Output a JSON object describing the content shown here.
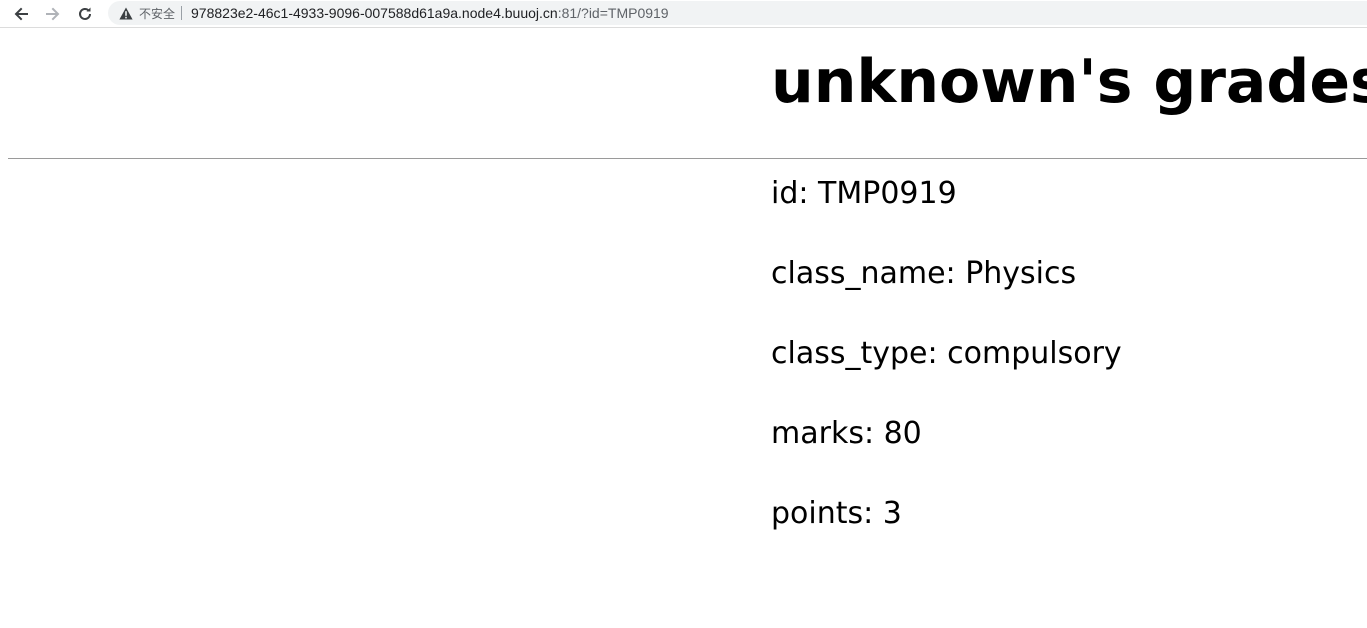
{
  "browser": {
    "security_label": "不安全",
    "url_host": "978823e2-46c1-4933-9096-007588d61a9a.node4.buuoj.cn",
    "url_rest": ":81/?id=TMP0919",
    "icons": {
      "back": "arrow-left-icon",
      "forward": "arrow-right-icon",
      "reload": "reload-icon",
      "warning": "warning-triangle-icon"
    }
  },
  "page": {
    "heading": "unknown's grades sheet",
    "fields": [
      {
        "key": "id",
        "value": "TMP0919",
        "text": "id: TMP0919"
      },
      {
        "key": "class_name",
        "value": "Physics",
        "text": "class_name: Physics"
      },
      {
        "key": "class_type",
        "value": "compulsory",
        "text": "class_type: compulsory"
      },
      {
        "key": "marks",
        "value": "80",
        "text": "marks: 80"
      },
      {
        "key": "points",
        "value": "3",
        "text": "points: 3"
      }
    ]
  }
}
